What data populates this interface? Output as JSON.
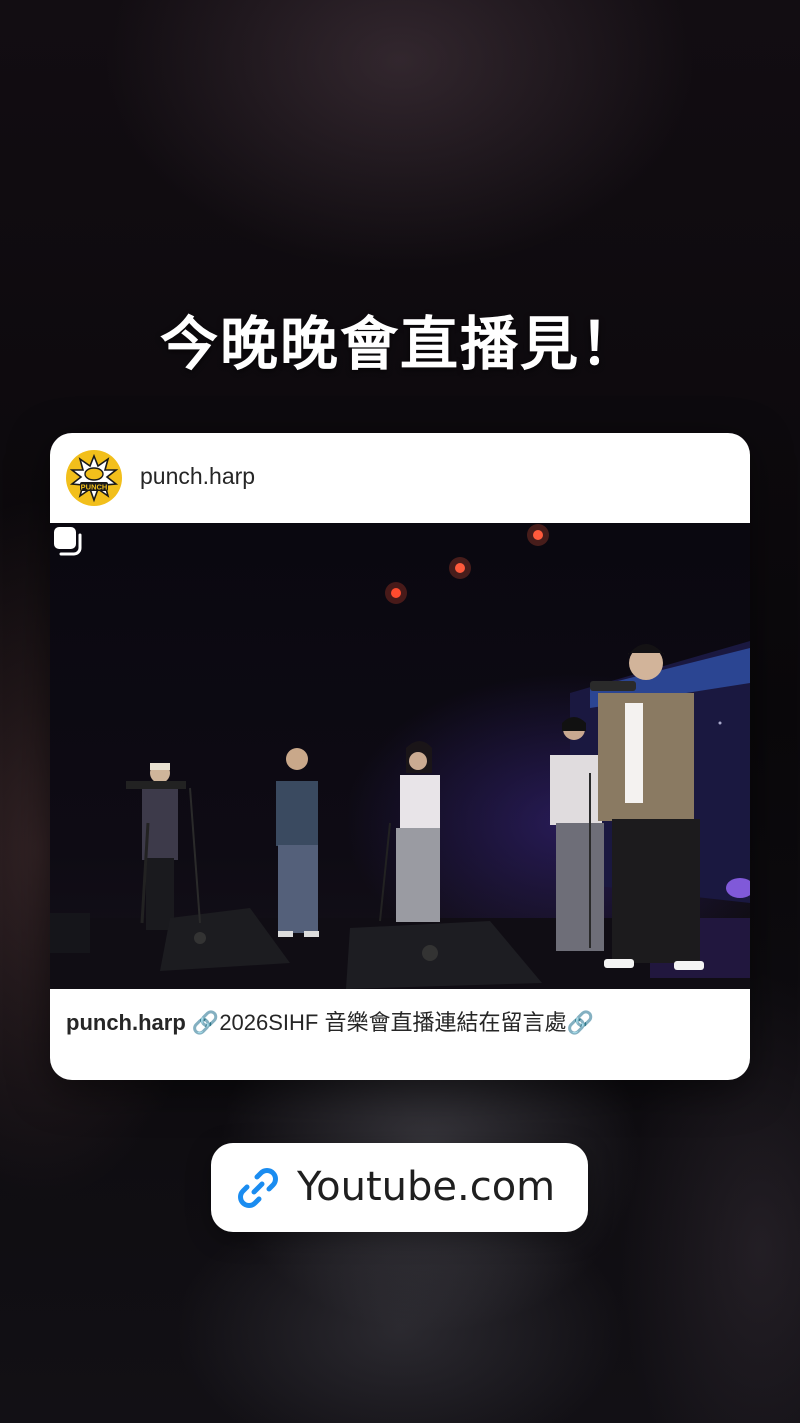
{
  "story": {
    "headline": "今晚晚會直播見！"
  },
  "post": {
    "username": "punch.harp",
    "avatar_text": "PUNCH",
    "caption_user": "punch.harp",
    "caption_text": "2026SIHF 音樂會直播連結在留言處",
    "caption_icon": "link-chain-icon",
    "multi_photo_icon": "carousel-icon"
  },
  "link_sticker": {
    "label": "Youtube.com",
    "icon": "link-icon"
  },
  "colors": {
    "accent_blue": "#1a8cf0",
    "avatar_yellow": "#f2bf1b",
    "card_bg": "#ffffff"
  }
}
